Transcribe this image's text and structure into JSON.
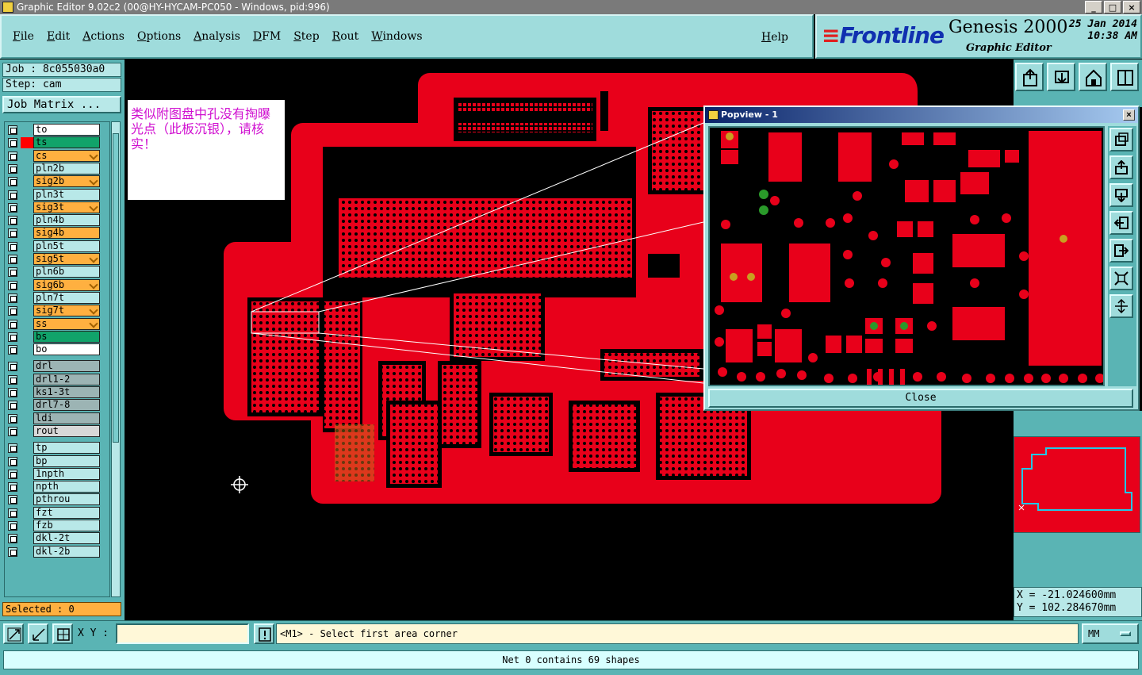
{
  "window": {
    "title": "Graphic Editor 9.02c2 (00@HY-HYCAM-PC050 - Windows, pid:996)"
  },
  "menu": {
    "items": [
      "File",
      "Edit",
      "Actions",
      "Options",
      "Analysis",
      "DFM",
      "Step",
      "Rout",
      "Windows"
    ],
    "help": "Help"
  },
  "brand": {
    "logo": "Frontline",
    "product": "Genesis 2000",
    "subtitle": "Graphic Editor",
    "date": "25 Jan 2014",
    "time": "10:38 AM"
  },
  "job": {
    "job_label": "Job : 8c055030a0",
    "step_label": "Step: cam",
    "matrix_button": "Job Matrix ..."
  },
  "layers": [
    {
      "name": "to",
      "color": "#ffffff",
      "mark": "",
      "arrow": false
    },
    {
      "name": "ts",
      "color": "#11a36a",
      "mark": "#ff0000",
      "arrow": false
    },
    {
      "name": "cs",
      "color": "#ffb040",
      "mark": "",
      "arrow": true
    },
    {
      "name": "pln2b",
      "color": "#b8e8e8",
      "mark": "",
      "arrow": false
    },
    {
      "name": "sig2b",
      "color": "#ffb040",
      "mark": "",
      "arrow": true
    },
    {
      "name": "pln3t",
      "color": "#b8e8e8",
      "mark": "",
      "arrow": false
    },
    {
      "name": "sig3t",
      "color": "#ffb040",
      "mark": "",
      "arrow": true
    },
    {
      "name": "pln4b",
      "color": "#b8e8e8",
      "mark": "",
      "arrow": false
    },
    {
      "name": "sig4b",
      "color": "#ffb040",
      "mark": "",
      "arrow": false
    },
    {
      "name": "pln5t",
      "color": "#b8e8e8",
      "mark": "",
      "arrow": false
    },
    {
      "name": "sig5t",
      "color": "#ffb040",
      "mark": "",
      "arrow": true
    },
    {
      "name": "pln6b",
      "color": "#b8e8e8",
      "mark": "",
      "arrow": false
    },
    {
      "name": "sig6b",
      "color": "#ffb040",
      "mark": "",
      "arrow": true
    },
    {
      "name": "pln7t",
      "color": "#b8e8e8",
      "mark": "",
      "arrow": false
    },
    {
      "name": "sig7t",
      "color": "#ffb040",
      "mark": "",
      "arrow": true
    },
    {
      "name": "ss",
      "color": "#ffb040",
      "mark": "",
      "arrow": true
    },
    {
      "name": "bs",
      "color": "#11a36a",
      "mark": "",
      "arrow": false
    },
    {
      "name": "bo",
      "color": "#ffffff",
      "mark": "",
      "arrow": false
    },
    {
      "name": "drl",
      "color": "#9cb4b4",
      "mark": "",
      "arrow": false
    },
    {
      "name": "drl1-2",
      "color": "#9cb4b4",
      "mark": "",
      "arrow": false
    },
    {
      "name": "ks1-3t",
      "color": "#9cb4b4",
      "mark": "",
      "arrow": false
    },
    {
      "name": "drl7-8",
      "color": "#9cb4b4",
      "mark": "",
      "arrow": false
    },
    {
      "name": "ldi",
      "color": "#9cb4b4",
      "mark": "",
      "arrow": false
    },
    {
      "name": "rout",
      "color": "#d8d8d8",
      "mark": "",
      "arrow": false
    },
    {
      "name": "tp",
      "color": "#b8e8e8",
      "mark": "",
      "arrow": false
    },
    {
      "name": "bp",
      "color": "#b8e8e8",
      "mark": "",
      "arrow": false
    },
    {
      "name": "1npth",
      "color": "#b8e8e8",
      "mark": "",
      "arrow": false
    },
    {
      "name": "npth",
      "color": "#b8e8e8",
      "mark": "",
      "arrow": false
    },
    {
      "name": "pthrou",
      "color": "#b8e8e8",
      "mark": "",
      "arrow": false
    },
    {
      "name": "fzt",
      "color": "#b8e8e8",
      "mark": "",
      "arrow": false
    },
    {
      "name": "fzb",
      "color": "#b8e8e8",
      "mark": "",
      "arrow": false
    },
    {
      "name": "dkl-2t",
      "color": "#b8e8e8",
      "mark": "",
      "arrow": false
    },
    {
      "name": "dkl-2b",
      "color": "#b8e8e8",
      "mark": "",
      "arrow": false
    }
  ],
  "selected": "Selected : 0",
  "note": {
    "text": "类似附图盘中孔没有掏曝光点（此板沉银），请核实！"
  },
  "popview": {
    "title": "Popview - 1",
    "close_label": "Close"
  },
  "coords": {
    "x": "X = -21.024600mm",
    "y": "Y = 102.284670mm"
  },
  "status": {
    "xy_label": "X Y :",
    "xy_value": "",
    "prompt": "<M1> - Select first area corner",
    "units": "MM",
    "net_message": "Net 0 contains 69 shapes"
  },
  "colors": {
    "board": "#e8001a",
    "panel": "#5ab4b4",
    "light": "#9fdcdc",
    "pad_green": "#2a9a2a",
    "pad_gold": "#c8a020"
  }
}
